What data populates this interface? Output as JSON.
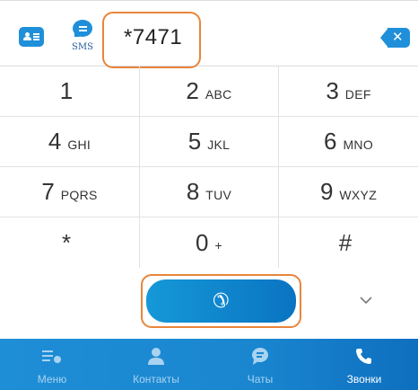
{
  "dialer": {
    "number": "*7471",
    "sms_label": "SMS",
    "icons": {
      "contacts": "contacts-card-icon",
      "sms": "sms-bubble-icon",
      "backspace": "backspace-icon",
      "call": "phone-icon",
      "collapse": "chevron-down-icon"
    },
    "keys": [
      {
        "digit": "1",
        "letters": ""
      },
      {
        "digit": "2",
        "letters": "ABC"
      },
      {
        "digit": "3",
        "letters": "DEF"
      },
      {
        "digit": "4",
        "letters": "GHI"
      },
      {
        "digit": "5",
        "letters": "JKL"
      },
      {
        "digit": "6",
        "letters": "MNO"
      },
      {
        "digit": "7",
        "letters": "PQRS"
      },
      {
        "digit": "8",
        "letters": "TUV"
      },
      {
        "digit": "9",
        "letters": "WXYZ"
      },
      {
        "digit": "*",
        "letters": ""
      },
      {
        "digit": "0",
        "letters": "+"
      },
      {
        "digit": "#",
        "letters": ""
      }
    ]
  },
  "bottom_nav": {
    "items": [
      {
        "label": "Меню",
        "icon": "menu-icon",
        "active": false
      },
      {
        "label": "Контакты",
        "icon": "person-icon",
        "active": false
      },
      {
        "label": "Чаты",
        "icon": "chat-icon",
        "active": false
      },
      {
        "label": "Звонки",
        "icon": "phone-icon",
        "active": true
      }
    ]
  },
  "colors": {
    "accent": "#1f8fd9",
    "highlight": "#e8853a",
    "nav_inactive": "#a9d3f0",
    "nav_active": "#ffffff"
  }
}
